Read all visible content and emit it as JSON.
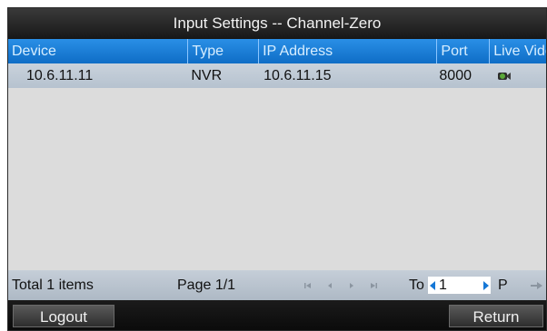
{
  "dialog": {
    "title": "Input Settings -- Channel-Zero"
  },
  "table": {
    "columns": [
      "Device",
      "Type",
      "IP Address",
      "Port",
      "Live Video"
    ],
    "rows": [
      {
        "device": "10.6.11.11",
        "type": "NVR",
        "ip": "10.6.11.15",
        "port": "8000",
        "live_icon": "camera-icon"
      }
    ]
  },
  "pagination": {
    "total": "Total 1 items",
    "page": "Page 1/1",
    "to_label": "To",
    "page_input_value": "1",
    "page_suffix": "P"
  },
  "buttons": {
    "logout": "Logout",
    "return": "Return"
  },
  "colors": {
    "header_blue": "#1a7fd8",
    "row_blue": "#bcc7d3",
    "dark": "#1a1a1a"
  }
}
